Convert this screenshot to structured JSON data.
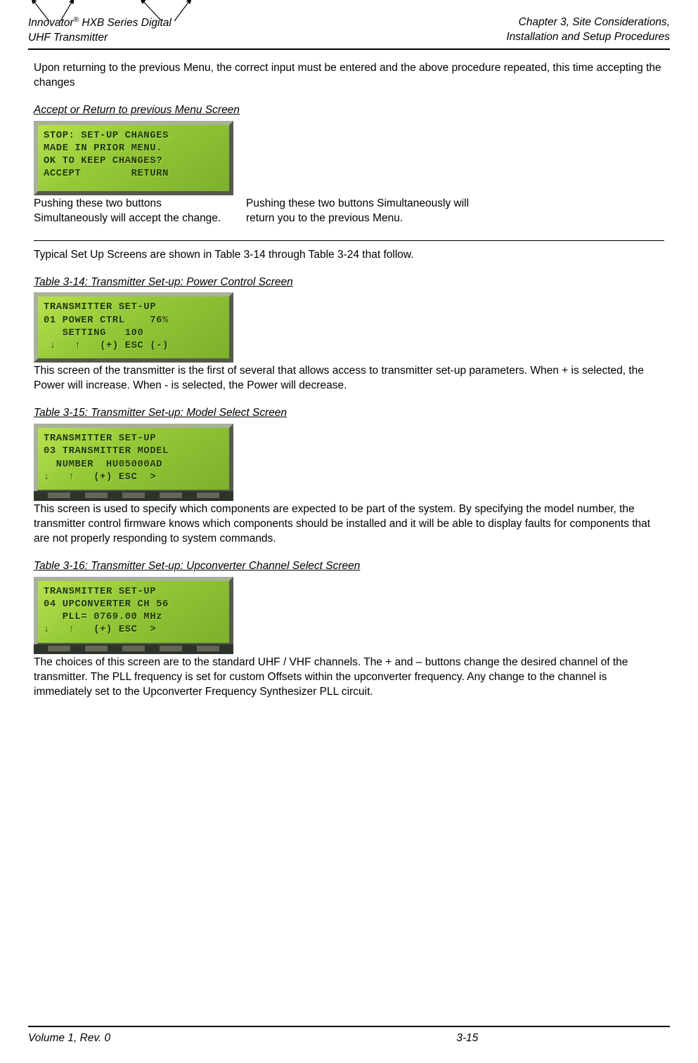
{
  "header": {
    "left_line1": "Innovator",
    "left_sup": "®",
    "left_line1b": " HXB Series Digital",
    "left_line2": "UHF Transmitter",
    "right_line1": "Chapter 3, Site Considerations,",
    "right_line2": "Installation and Setup Procedures"
  },
  "intro_para": "Upon returning to the previous Menu, the correct input must be entered and the above procedure repeated, this time accepting the changes",
  "accept_caption": "Accept or Return to previous Menu Screen",
  "lcd1": {
    "line1": "STOP: SET-UP CHANGES",
    "line2": "MADE IN PRIOR MENU.",
    "line3": "OK TO KEEP CHANGES?",
    "line4": "ACCEPT        RETURN"
  },
  "anno_left": "Pushing these two buttons Simultaneously will accept the change.",
  "anno_right": "Pushing these two buttons Simultaneously will return you to the previous Menu.",
  "typical_para": "Typical Set Up Screens are shown in Table 3-14 through Table 3-24 that follow.",
  "table14": {
    "caption": "Table 3-14: Transmitter Set-up: Power Control Screen",
    "line1": "TRANSMITTER SET-UP",
    "line2": "01 POWER CTRL    76%",
    "line3": "   SETTING   100",
    "line4": " ↓   ↑   (+) ESC (-)",
    "desc": "This screen of the transmitter is the first of several that allows access to transmitter set-up parameters. When + is selected, the Power will increase.  When - is selected, the Power will decrease."
  },
  "table15": {
    "caption": "Table 3-15: Transmitter Set-up: Model Select Screen",
    "line1": "TRANSMITTER SET-UP",
    "line2": "03 TRANSMITTER MODEL",
    "line3": "  NUMBER  HU05000AD",
    "line4": "↓   ↑   (+) ESC  >",
    "desc": "This screen is used to specify which components are expected to be part of the system. By specifying the model number, the transmitter control firmware knows which components should be installed and it will be able to display faults for components that are not properly responding to system commands."
  },
  "table16": {
    "caption": "Table 3-16: Transmitter Set-up: Upconverter Channel Select Screen",
    "line1": "TRANSMITTER SET-UP",
    "line2": "04 UPCONVERTER CH 56",
    "line3": "   PLL= 0769.00 MHz",
    "line4": "↓   ↑   (+) ESC  >",
    "desc": "The choices of this screen are to the standard UHF / VHF channels.  The + and – buttons change the desired channel of the transmitter.  The PLL frequency is set for custom Offsets within the upconverter frequency. Any change to the channel is immediately set to the Upconverter Frequency Synthesizer PLL circuit."
  },
  "footer": {
    "left": "Volume 1, Rev. 0",
    "center": "3-15"
  }
}
